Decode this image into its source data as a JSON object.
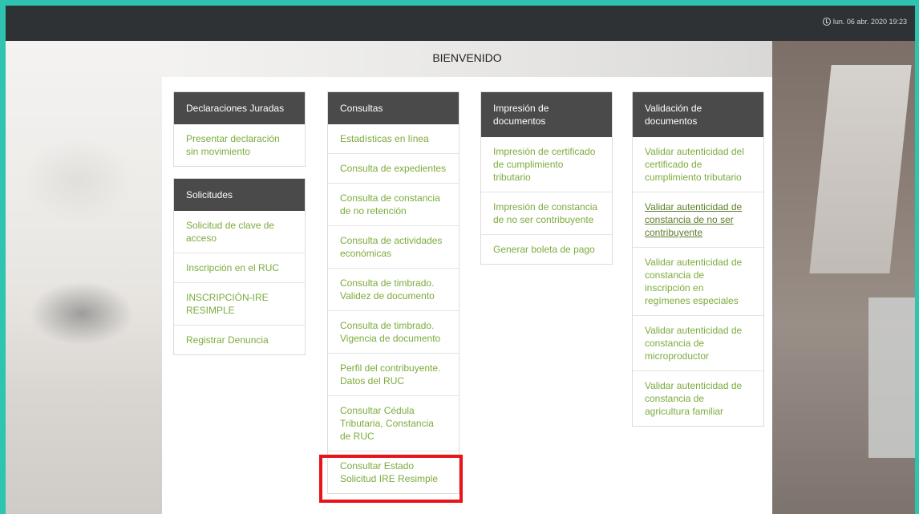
{
  "topbar": {
    "clock_text": "lun. 06 abr. 2020 19:23"
  },
  "page": {
    "title": "BIENVENIDO"
  },
  "columns": [
    {
      "cards": [
        {
          "title": "Declaraciones Juradas",
          "items": [
            "Presentar declaración sin movimiento"
          ]
        },
        {
          "title": "Solicitudes",
          "items": [
            "Solicitud de clave de acceso",
            "Inscripción en el RUC",
            "INSCRIPCIÓN-IRE RESIMPLE",
            "Registrar Denuncia"
          ]
        }
      ]
    },
    {
      "cards": [
        {
          "title": "Consultas",
          "items": [
            "Estadísticas en línea",
            "Consulta de expedientes",
            "Consulta de constancia de no retención",
            "Consulta de actividades económicas",
            "Consulta de timbrado. Validez de documento",
            "Consulta de timbrado. Vigencia de documento",
            "Perfil del contribuyente. Datos del RUC",
            "Consultar Cédula Tributaria, Constancia de RUC",
            "Consultar Estado Solicitud IRE Resimple"
          ]
        }
      ]
    },
    {
      "cards": [
        {
          "title": "Impresión de documentos",
          "items": [
            "Impresión de certificado de cumplimiento tributario",
            "Impresión de constancia de no ser contribuyente",
            "Generar boleta de pago"
          ]
        }
      ]
    },
    {
      "cards": [
        {
          "title": "Validación de documentos",
          "items": [
            "Validar autenticidad del certificado de cumplimiento tributario",
            "Validar autenticidad de constancia de no ser contribuyente",
            "Validar autenticidad de constancia de inscripción en regímenes especiales",
            "Validar autenticidad de constancia de microproductor",
            "Validar autenticidad de constancia de agricultura familiar"
          ]
        }
      ]
    }
  ],
  "colors": {
    "accent_link": "#7cab3c",
    "card_header_bg": "#4a4a4a",
    "highlight": "#e8141a",
    "frame": "#2ec4b0"
  }
}
